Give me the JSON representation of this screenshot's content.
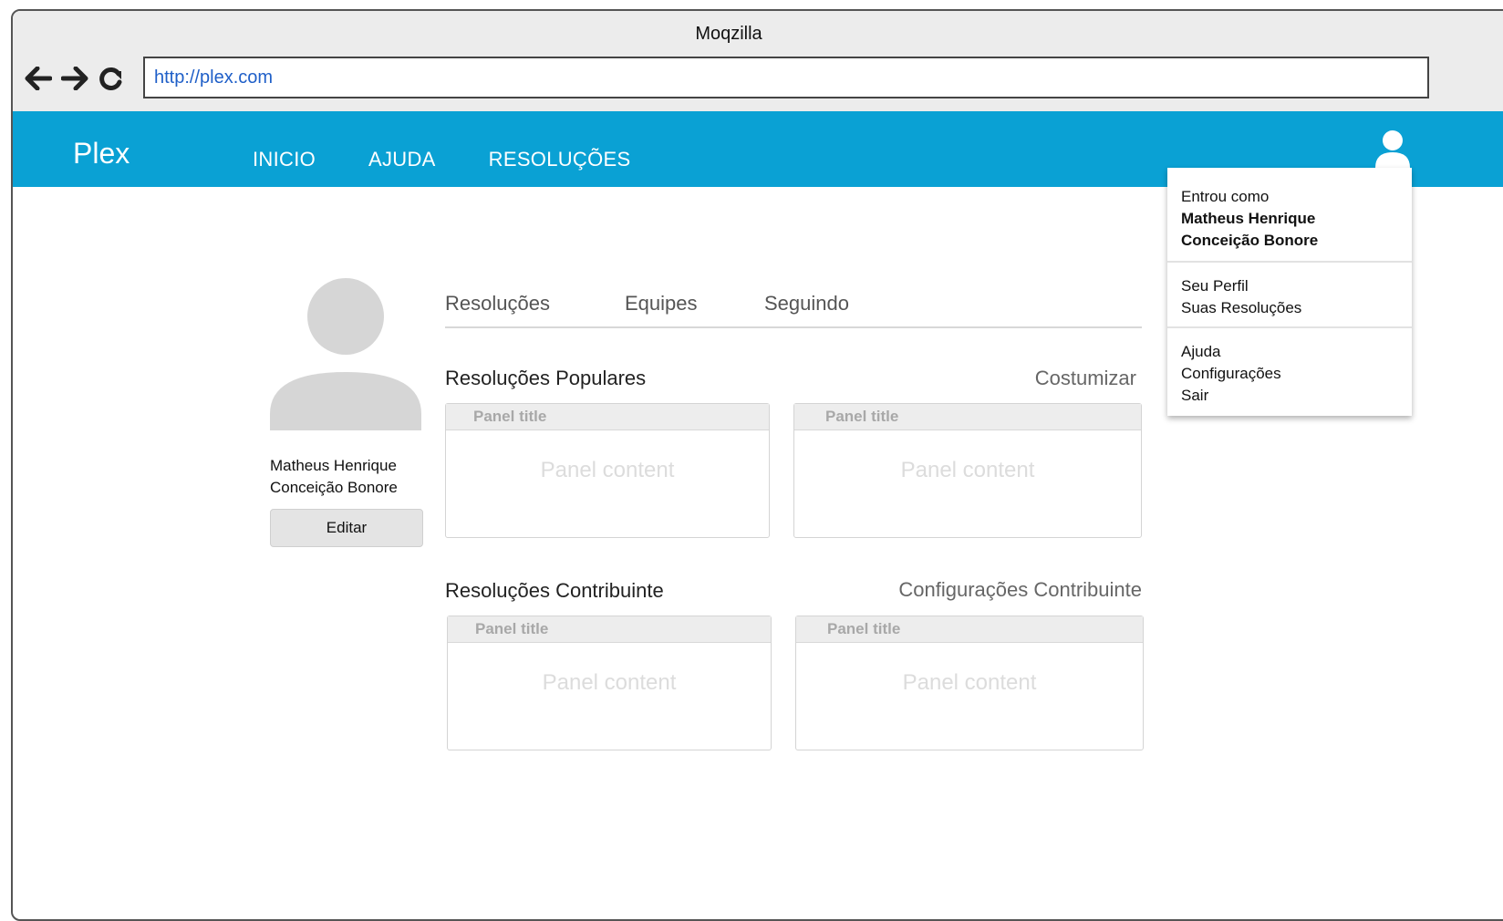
{
  "browser": {
    "title": "Moqzilla",
    "url": "http://plex.com"
  },
  "app": {
    "brand": "Plex",
    "menu": [
      "INICIO",
      "AJUDA",
      "RESOLUÇÕES"
    ]
  },
  "profile": {
    "name_line1": "Matheus Henrique",
    "name_line2": "Conceição Bonore",
    "edit_label": "Editar"
  },
  "tabs": [
    "Resoluções",
    "Equipes",
    "Seguindo"
  ],
  "sections": {
    "popular": {
      "title": "Resoluções Populares",
      "link": "Costumizar"
    },
    "contributor": {
      "title": "Resoluções Contribuinte",
      "link": "Configurações Contribuinte"
    }
  },
  "panels": [
    {
      "title": "Panel title",
      "content": "Panel content"
    },
    {
      "title": "Panel title",
      "content": "Panel content"
    },
    {
      "title": "Panel title",
      "content": "Panel content"
    },
    {
      "title": "Panel title",
      "content": "Panel content"
    }
  ],
  "dropdown": {
    "signed_in_label": "Entrou como",
    "user_line1": "Matheus Henrique",
    "user_line2": "Conceição Bonore",
    "profile": "Seu Perfil",
    "resolutions": "Suas Resoluções",
    "help": "Ajuda",
    "settings": "Configurações",
    "logout": "Sair"
  },
  "colors": {
    "appbar": "#0aa1d4",
    "link": "#1f5fc8"
  },
  "icons": {
    "back": "arrow-left-icon",
    "forward": "arrow-right-icon",
    "reload": "reload-icon",
    "user": "user-icon"
  }
}
